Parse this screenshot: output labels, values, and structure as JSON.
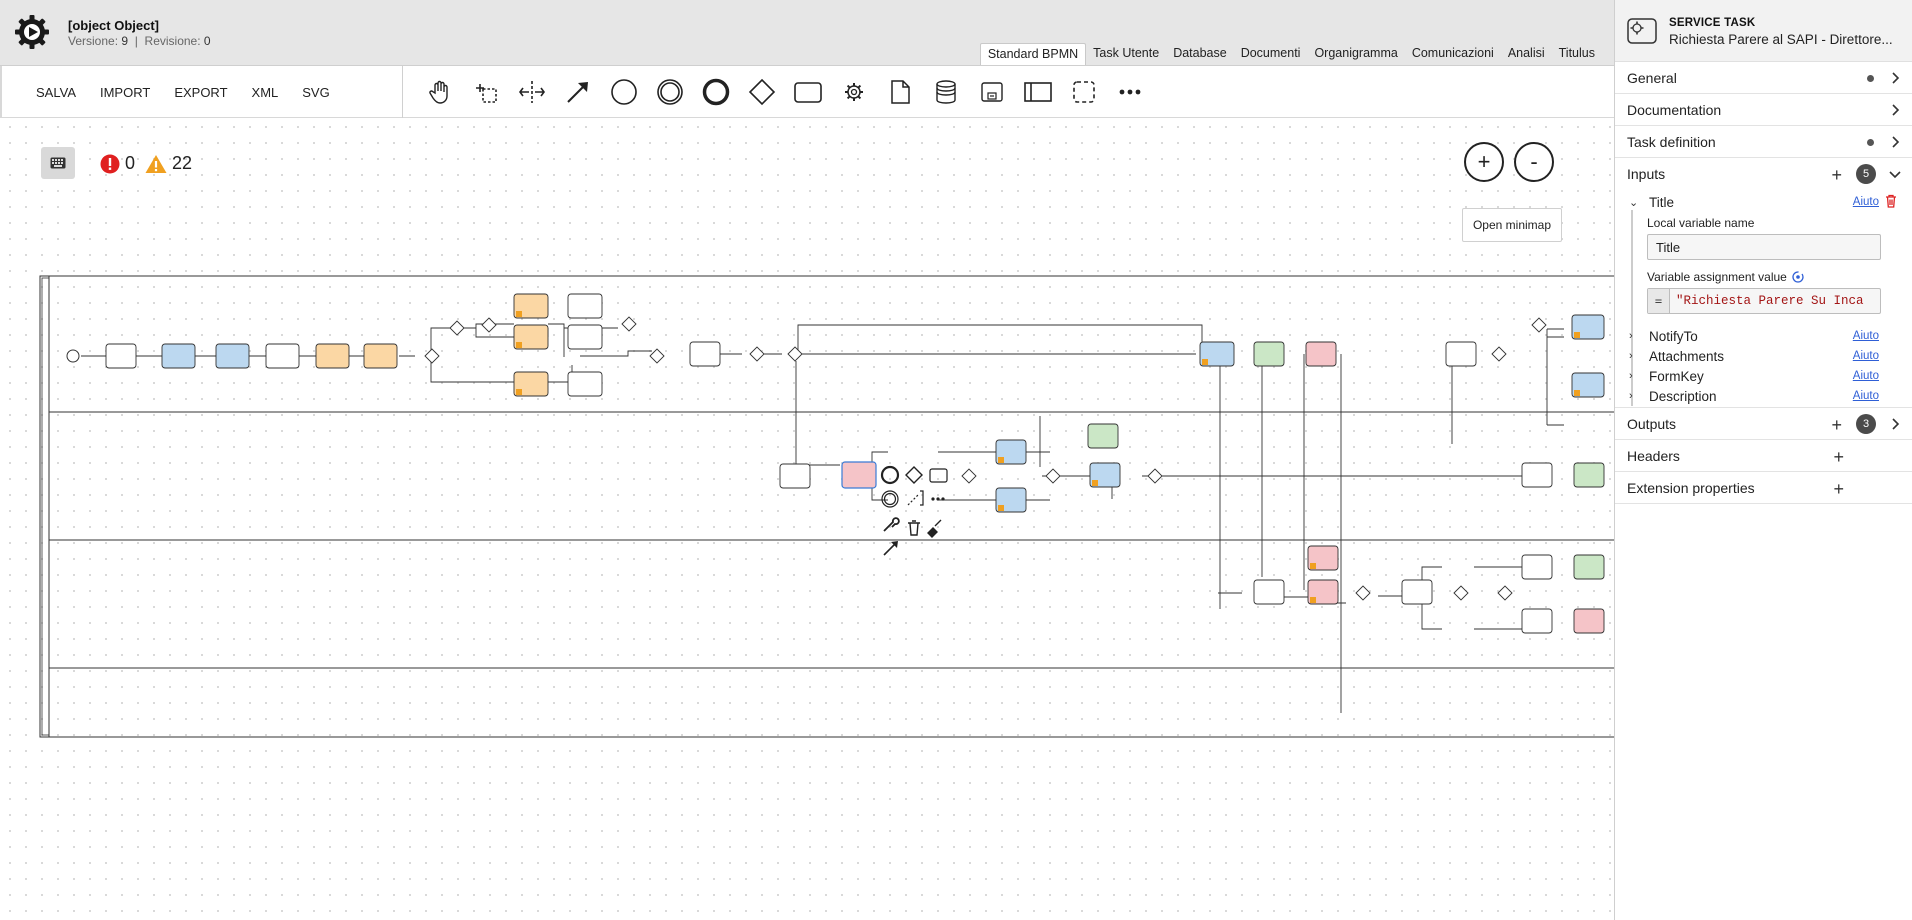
{
  "header": {
    "title": "[object Object]",
    "version_label": "Versione:",
    "version": "9",
    "revision_label": "Revisione:",
    "revision": "0"
  },
  "view_tabs": [
    "Standard BPMN",
    "Task Utente",
    "Database",
    "Documenti",
    "Organigramma",
    "Comunicazioni",
    "Analisi",
    "Titulus"
  ],
  "active_tab": "Standard BPMN",
  "toolbar": {
    "actions": [
      "SALVA",
      "IMPORT",
      "EXPORT",
      "XML",
      "SVG"
    ],
    "palette": [
      "hand-tool-icon",
      "lasso-tool-icon",
      "space-tool-icon",
      "global-connect-icon",
      "start-event-icon",
      "intermediate-event-icon",
      "end-event-icon",
      "gateway-icon",
      "task-icon",
      "service-task-icon",
      "data-object-icon",
      "data-store-icon",
      "subprocess-icon",
      "pool-icon",
      "group-icon",
      "more-icon"
    ]
  },
  "canvas": {
    "errors": "0",
    "warnings": "22",
    "zoom_in": "+",
    "zoom_out": "-",
    "minimap": "Open minimap"
  },
  "panel": {
    "type": "SERVICE TASK",
    "name": "Richiesta Parere al SAPI - Direttore...",
    "groups": {
      "general": "General",
      "documentation": "Documentation",
      "task_definition": "Task definition",
      "inputs": "Inputs",
      "inputs_count": "5",
      "outputs": "Outputs",
      "outputs_count": "3",
      "headers": "Headers",
      "extension": "Extension properties"
    },
    "input_items": [
      "Title",
      "NotifyTo",
      "Attachments",
      "FormKey",
      "Description"
    ],
    "help_label": "Aiuto",
    "title_item": {
      "local_var_label": "Local variable name",
      "local_var_value": "Title",
      "assign_label": "Variable assignment value",
      "assign_prefix": "=",
      "assign_value": "\"Richiesta Parere Su Inca"
    }
  },
  "colors": {
    "header_bg": "#e6e6e6",
    "accent_blue": "#2f5fd6",
    "task_blue": "#bcd8f0",
    "task_orange": "#fbd7a4",
    "task_green": "#cbe7c6",
    "task_red": "#f5c4c8",
    "error_red": "#e02020",
    "warning_orange": "#f0a020"
  }
}
